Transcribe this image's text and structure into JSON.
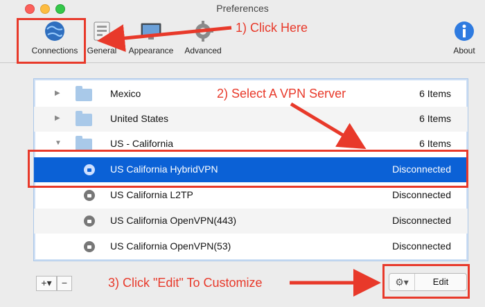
{
  "window": {
    "title": "Preferences"
  },
  "toolbar": {
    "items": [
      {
        "label": "Connections",
        "icon": "globe-icon"
      },
      {
        "label": "General",
        "icon": "general-icon"
      },
      {
        "label": "Appearance",
        "icon": "display-icon"
      },
      {
        "label": "Advanced",
        "icon": "gear-icon"
      },
      {
        "label": "About",
        "icon": "info-icon"
      }
    ]
  },
  "list": {
    "rows": [
      {
        "name": "Mexico",
        "status": "6 Items"
      },
      {
        "name": "United States",
        "status": "6 Items"
      },
      {
        "name": "US - California",
        "status": "6 Items"
      },
      {
        "name": "US California HybridVPN",
        "status": "Disconnected"
      },
      {
        "name": "US California L2TP",
        "status": "Disconnected"
      },
      {
        "name": "US California OpenVPN(443)",
        "status": "Disconnected"
      },
      {
        "name": "US California OpenVPN(53)",
        "status": "Disconnected"
      }
    ]
  },
  "footer": {
    "add_label": "+▾",
    "remove_label": "−",
    "edit_label": "Edit"
  },
  "annotations": {
    "step1": "1) Click Here",
    "step2": "2) Select A VPN Server",
    "step3": "3) Click \"Edit\" To Customize"
  },
  "colors": {
    "accent": "#0b61d6",
    "annotation": "#e8392a"
  }
}
